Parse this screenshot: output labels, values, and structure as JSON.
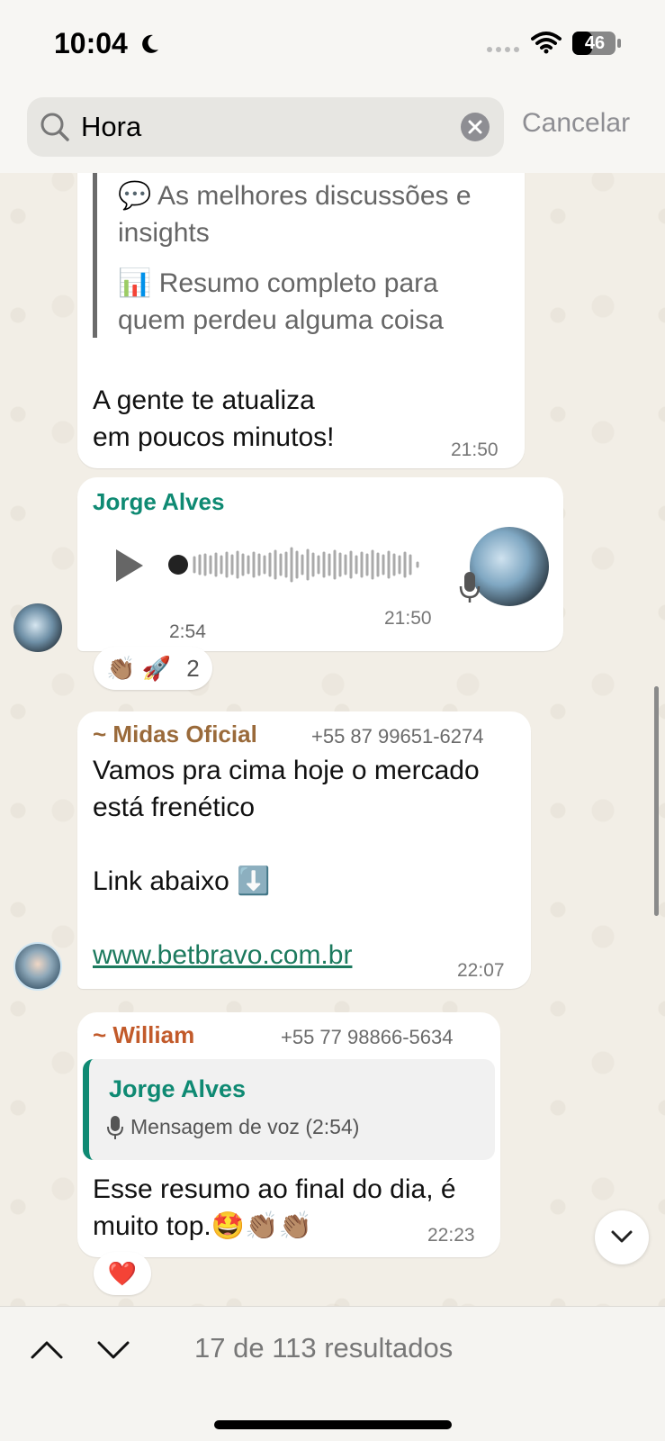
{
  "status_bar": {
    "time": "10:04",
    "battery": "46"
  },
  "search": {
    "query": "Hora",
    "cancel_label": "Cancelar"
  },
  "messages": [
    {
      "quote_lines": [
        "💬 As melhores discussões e",
        "insights",
        "📊 Resumo completo para",
        "quem perdeu alguma coisa"
      ],
      "text_lines": [
        "A gente te atualiza",
        "em poucos minutos!"
      ],
      "time": "21:50"
    },
    {
      "sender": "Jorge Alves",
      "sender_color": "#0f8a73",
      "type": "voice",
      "duration": "2:54",
      "time": "21:50",
      "reactions": "👏🏽 🚀",
      "reaction_count": "2"
    },
    {
      "sender": "~ Midas Oficial",
      "sender_color": "#9a6a3a",
      "phone": "+55 87 99651-6274",
      "text_lines": [
        "Vamos pra cima hoje o mercado",
        "está frenético",
        "",
        "Link abaixo ⬇️"
      ],
      "link": "www.betbravo.com.br",
      "time": "22:07"
    },
    {
      "sender": "~ William",
      "sender_color": "#c25a2a",
      "phone": "+55 77 98866-5634",
      "reply_sender": "Jorge Alves",
      "reply_text": "Mensagem de voz (2:54)",
      "text_lines": [
        "Esse resumo ao final do dia, é",
        "muito top.🤩👏🏽👏🏽"
      ],
      "time": "22:23",
      "reactions": "❤️"
    }
  ],
  "footer": {
    "results": "17 de 113 resultados"
  },
  "colors": {
    "accent": "#0f8a73",
    "background": "#f3efe8"
  }
}
